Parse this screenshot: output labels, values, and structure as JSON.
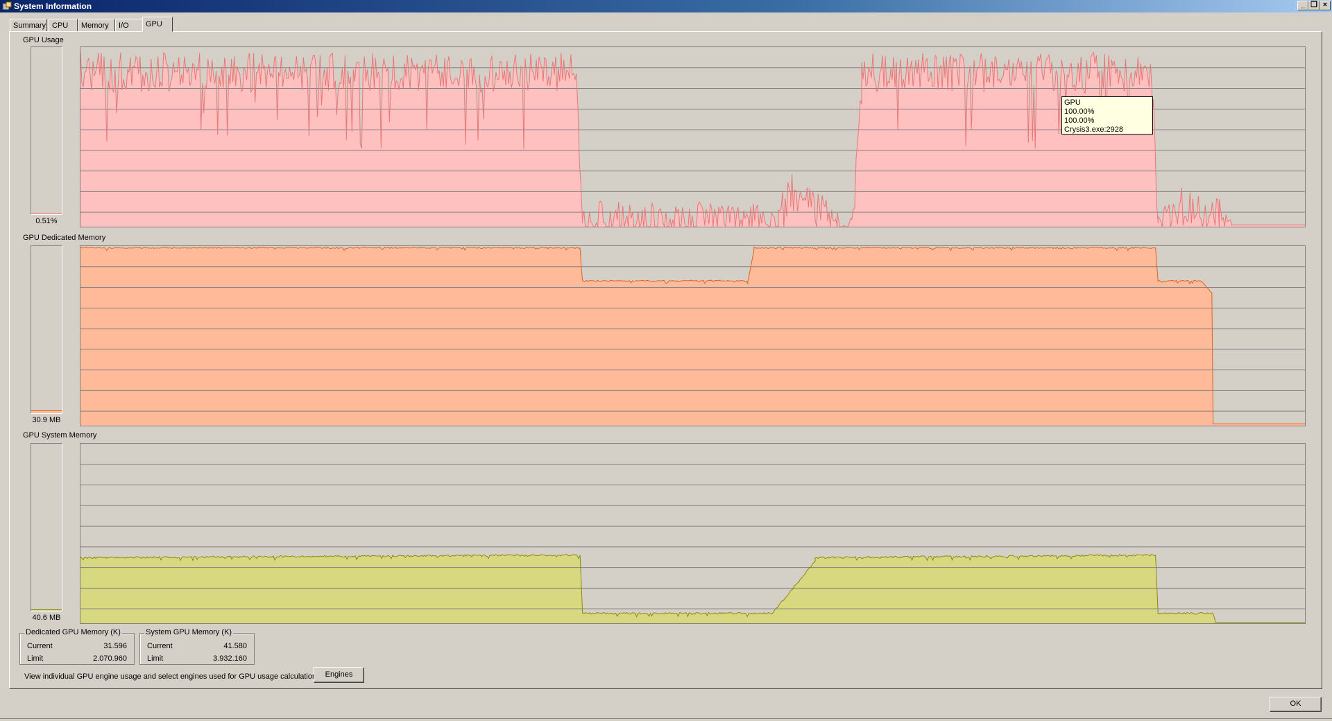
{
  "window": {
    "title": "System Information",
    "controls": [
      "minimize-icon",
      "restore-icon",
      "close-icon"
    ]
  },
  "tabs": [
    {
      "label": "Summary",
      "active": false
    },
    {
      "label": "CPU",
      "active": false
    },
    {
      "label": "Memory",
      "active": false
    },
    {
      "label": "I/O",
      "active": false
    },
    {
      "label": "GPU",
      "active": true
    }
  ],
  "graphs": {
    "usage": {
      "label": "GPU Usage",
      "meter_value": "0.51%",
      "meter_fraction": 0.0051,
      "color": "#ffc0c0",
      "line_color": "#e87878"
    },
    "dedicated": {
      "label": "GPU Dedicated Memory",
      "meter_value": "30.9 MB",
      "meter_fraction": 0.015,
      "color": "#ffbb99",
      "line_color": "#e06020"
    },
    "system": {
      "label": "GPU System Memory",
      "meter_value": "40.6 MB",
      "meter_fraction": 0.01,
      "color": "#d8d880",
      "line_color": "#8a8a10"
    }
  },
  "tooltip": {
    "line1": "GPU",
    "line2": "100.00%",
    "line3": "100.00%",
    "line4": "Crysis3.exe:2928"
  },
  "dedicated_box": {
    "title": "Dedicated GPU Memory (K)",
    "current_label": "Current",
    "current_value": "31.596",
    "limit_label": "Limit",
    "limit_value": "2.070.960"
  },
  "system_box": {
    "title": "System GPU Memory (K)",
    "current_label": "Current",
    "current_value": "41.580",
    "limit_label": "Limit",
    "limit_value": "3.932.160"
  },
  "footer": {
    "text": "View individual GPU engine usage and select engines used for GPU usage calculations:",
    "engines_button": "Engines"
  },
  "ok_button": "OK"
}
